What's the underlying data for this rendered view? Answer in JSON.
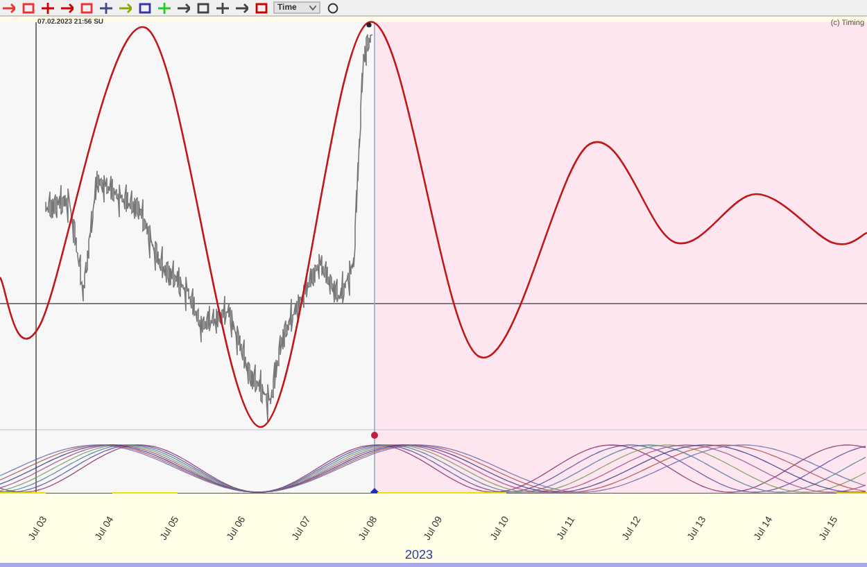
{
  "toolbar": {
    "dropdown": {
      "value": "Time"
    }
  },
  "chart": {
    "timestamp": "07.02.2023 21:56 SU",
    "copyright": "(c) Timing"
  },
  "axis": {
    "labels": [
      "Jul 03",
      "Jul 04",
      "Jul 05",
      "Jul 06",
      "Jul 07",
      "Jul 08",
      "Jul 09",
      "Jul 10",
      "Jul 11",
      "Jul 12",
      "Jul 13",
      "Jul 14",
      "Jul 15"
    ],
    "year": "2023"
  }
}
